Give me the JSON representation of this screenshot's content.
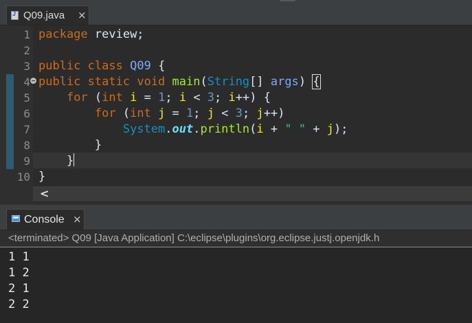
{
  "editor": {
    "tab_label": "Q09.java",
    "tab_close": "×",
    "line_numbers": [
      "1",
      "2",
      "3",
      "4",
      "5",
      "6",
      "7",
      "8",
      "9",
      "10"
    ]
  },
  "code": {
    "l1": {
      "kw": "package",
      "rest": " review;"
    },
    "l3": {
      "kw1": "public",
      "kw2": "class",
      "name": "Q09",
      "rest": " {"
    },
    "l4": {
      "kw1": "public",
      "kw2": "static",
      "kw3": "void",
      "method": "main",
      "p1": "(",
      "type": "String",
      "p2": "[] ",
      "arg": "args",
      "p3": ") ",
      "brace": "{"
    },
    "l5": {
      "indent": "    ",
      "kw": "for",
      "p1": " (",
      "kw2": "int",
      "sp": " ",
      "v1": "i",
      "p2": " = ",
      "n1": "1",
      "p3": "; ",
      "v2": "i",
      "p4": " < ",
      "n2": "3",
      "p5": "; ",
      "v3": "i",
      "p6": "++) {"
    },
    "l6": {
      "indent": "        ",
      "kw": "for",
      "p1": " (",
      "kw2": "int",
      "sp": " ",
      "v1": "j",
      "p2": " = ",
      "n1": "1",
      "p3": "; ",
      "v2": "j",
      "p4": " < ",
      "n2": "3",
      "p5": "; ",
      "v3": "j",
      "p6": "++)"
    },
    "l7": {
      "indent": "            ",
      "cls": "System",
      "dot1": ".",
      "field": "out",
      "dot2": ".",
      "method": "println",
      "p1": "(",
      "v1": "i",
      "p2": " + ",
      "str": "\" \"",
      "p3": " + ",
      "v2": "j",
      "p4": ");"
    },
    "l8": {
      "text": "        }"
    },
    "l9": {
      "text": "    }"
    },
    "l10": {
      "text": "}"
    }
  },
  "scroll": {
    "arrow": "<"
  },
  "console": {
    "tab_label": "Console",
    "tab_close": "×",
    "status": "<terminated> Q09 [Java Application] C:\\eclipse\\plugins\\org.eclipse.justj.openjdk.h",
    "output": [
      "1 1",
      "1 2",
      "2 1",
      "2 2"
    ]
  }
}
